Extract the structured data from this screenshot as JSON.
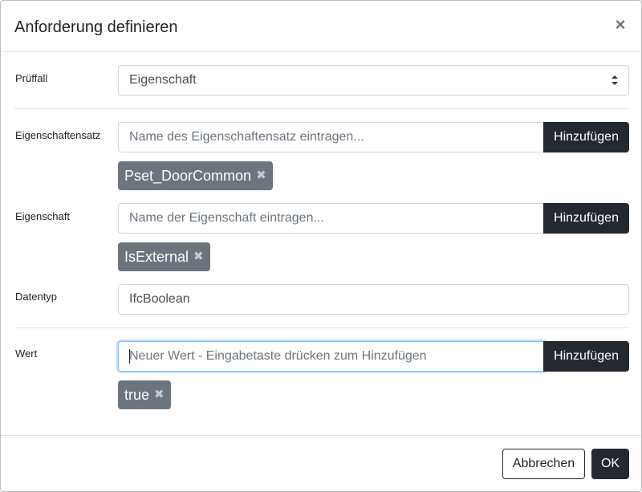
{
  "dialog": {
    "title": "Anforderung definieren",
    "close_icon": "close-icon"
  },
  "pruefall": {
    "label": "Prüffall",
    "value": "Eigenschaft"
  },
  "eigenschaftensatz": {
    "label": "Eigenschaftensatz",
    "placeholder": "Name des Eigenschaftensatz eintragen...",
    "add_label": "Hinzufügen",
    "chips": [
      "Pset_DoorCommon"
    ]
  },
  "eigenschaft": {
    "label": "Eigenschaft",
    "placeholder": "Name der Eigenschaft eintragen...",
    "add_label": "Hinzufügen",
    "chips": [
      "IsExternal"
    ]
  },
  "datentyp": {
    "label": "Datentyp",
    "value": "IfcBoolean"
  },
  "wert": {
    "label": "Wert",
    "placeholder": "Neuer Wert - Eingabetaste drücken zum Hinzufügen",
    "add_label": "Hinzufügen",
    "chips": [
      "true"
    ]
  },
  "footer": {
    "cancel_label": "Abbrechen",
    "ok_label": "OK"
  },
  "colors": {
    "dark_button": "#23292e",
    "chip": "#6c757d",
    "focus": "#80bdff"
  }
}
